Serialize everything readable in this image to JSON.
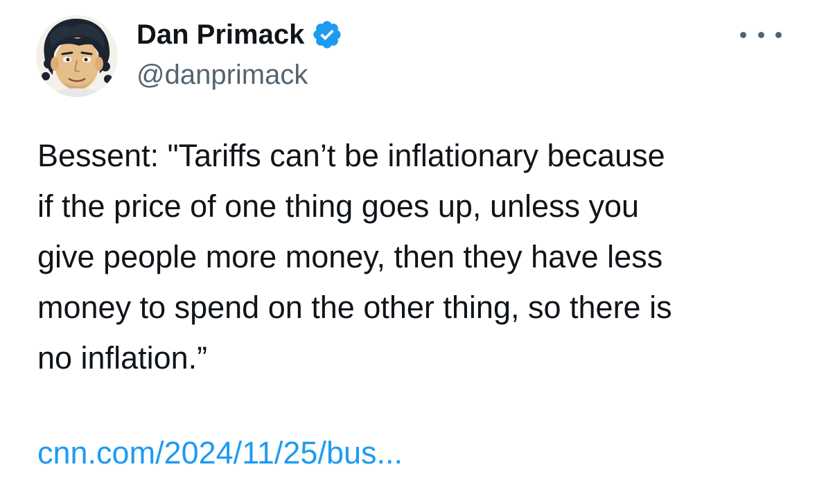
{
  "author": {
    "display_name": "Dan Primack",
    "handle": "@danprimack",
    "verified": true,
    "avatar_icon": "cartoon-portrait-avatar"
  },
  "tweet": {
    "text": "Bessent: \"Tariffs can’t be inflationary because\nif the price of one thing goes up, unless you\ngive people more money, then they have less\nmoney to spend on the other thing, so there is\nno inflation.”",
    "link_text": "cnn.com/2024/11/25/bus..."
  },
  "colors": {
    "text_primary": "#0f1419",
    "text_secondary": "#536471",
    "link": "#1d9bf0",
    "verified_badge": "#1d9bf0"
  },
  "icons": {
    "verified": "verified-badge-icon",
    "more": "more-options-icon"
  }
}
